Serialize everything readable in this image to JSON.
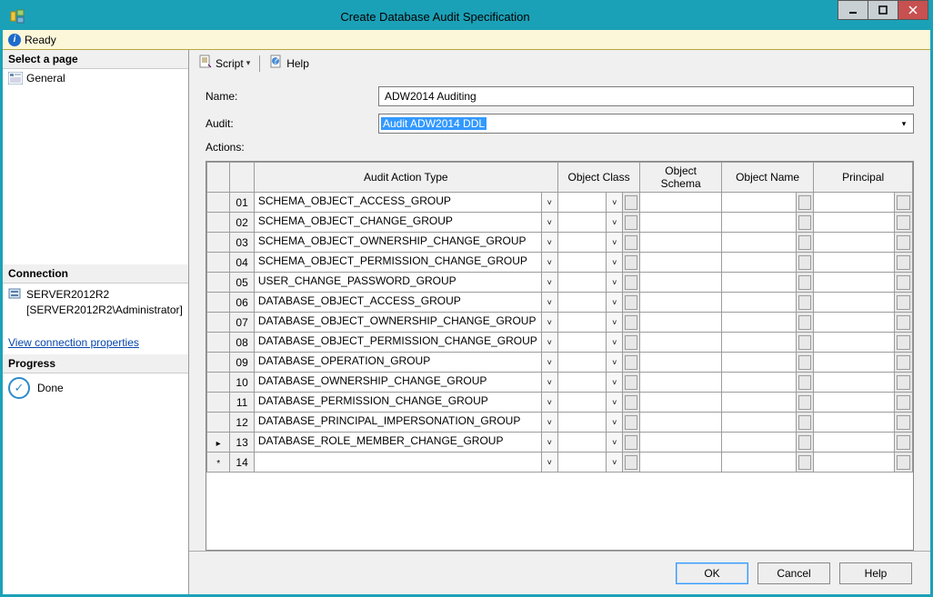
{
  "window": {
    "title": "Create Database Audit Specification"
  },
  "status": {
    "text": "Ready"
  },
  "sidebar": {
    "select_page_heading": "Select a page",
    "pages": [
      {
        "label": "General"
      }
    ],
    "connection_heading": "Connection",
    "server_name": "SERVER2012R2",
    "server_identity": "[SERVER2012R2\\Administrator]",
    "view_conn_link": "View connection properties",
    "progress_heading": "Progress",
    "progress_text": "Done"
  },
  "toolbar": {
    "script_label": "Script",
    "help_label": "Help"
  },
  "form": {
    "name_label": "Name:",
    "name_value": "ADW2014 Auditing",
    "audit_label": "Audit:",
    "audit_value": "Audit ADW2014 DDL",
    "actions_label": "Actions:"
  },
  "grid": {
    "headers": {
      "action_type": "Audit Action Type",
      "object_class": "Object Class",
      "object_schema": "Object Schema",
      "object_name": "Object Name",
      "principal": "Principal"
    },
    "rows": [
      {
        "n": "01",
        "marker": "",
        "action": "SCHEMA_OBJECT_ACCESS_GROUP",
        "cls": ""
      },
      {
        "n": "02",
        "marker": "",
        "action": "SCHEMA_OBJECT_CHANGE_GROUP",
        "cls": ""
      },
      {
        "n": "03",
        "marker": "",
        "action": "SCHEMA_OBJECT_OWNERSHIP_CHANGE_GROUP",
        "cls": ""
      },
      {
        "n": "04",
        "marker": "",
        "action": "SCHEMA_OBJECT_PERMISSION_CHANGE_GROUP",
        "cls": ""
      },
      {
        "n": "05",
        "marker": "",
        "action": "USER_CHANGE_PASSWORD_GROUP",
        "cls": ""
      },
      {
        "n": "06",
        "marker": "",
        "action": "DATABASE_OBJECT_ACCESS_GROUP",
        "cls": ""
      },
      {
        "n": "07",
        "marker": "",
        "action": "DATABASE_OBJECT_OWNERSHIP_CHANGE_GROUP",
        "cls": ""
      },
      {
        "n": "08",
        "marker": "",
        "action": "DATABASE_OBJECT_PERMISSION_CHANGE_GROUP",
        "cls": ""
      },
      {
        "n": "09",
        "marker": "",
        "action": "DATABASE_OPERATION_GROUP",
        "cls": ""
      },
      {
        "n": "10",
        "marker": "",
        "action": "DATABASE_OWNERSHIP_CHANGE_GROUP",
        "cls": ""
      },
      {
        "n": "11",
        "marker": "",
        "action": "DATABASE_PERMISSION_CHANGE_GROUP",
        "cls": ""
      },
      {
        "n": "12",
        "marker": "",
        "action": "DATABASE_PRINCIPAL_IMPERSONATION_GROUP",
        "cls": ""
      },
      {
        "n": "13",
        "marker": "▸",
        "action": "DATABASE_ROLE_MEMBER_CHANGE_GROUP",
        "cls": ""
      },
      {
        "n": "14",
        "marker": "*",
        "action": "",
        "cls": ""
      }
    ]
  },
  "footer": {
    "ok": "OK",
    "cancel": "Cancel",
    "help": "Help"
  }
}
